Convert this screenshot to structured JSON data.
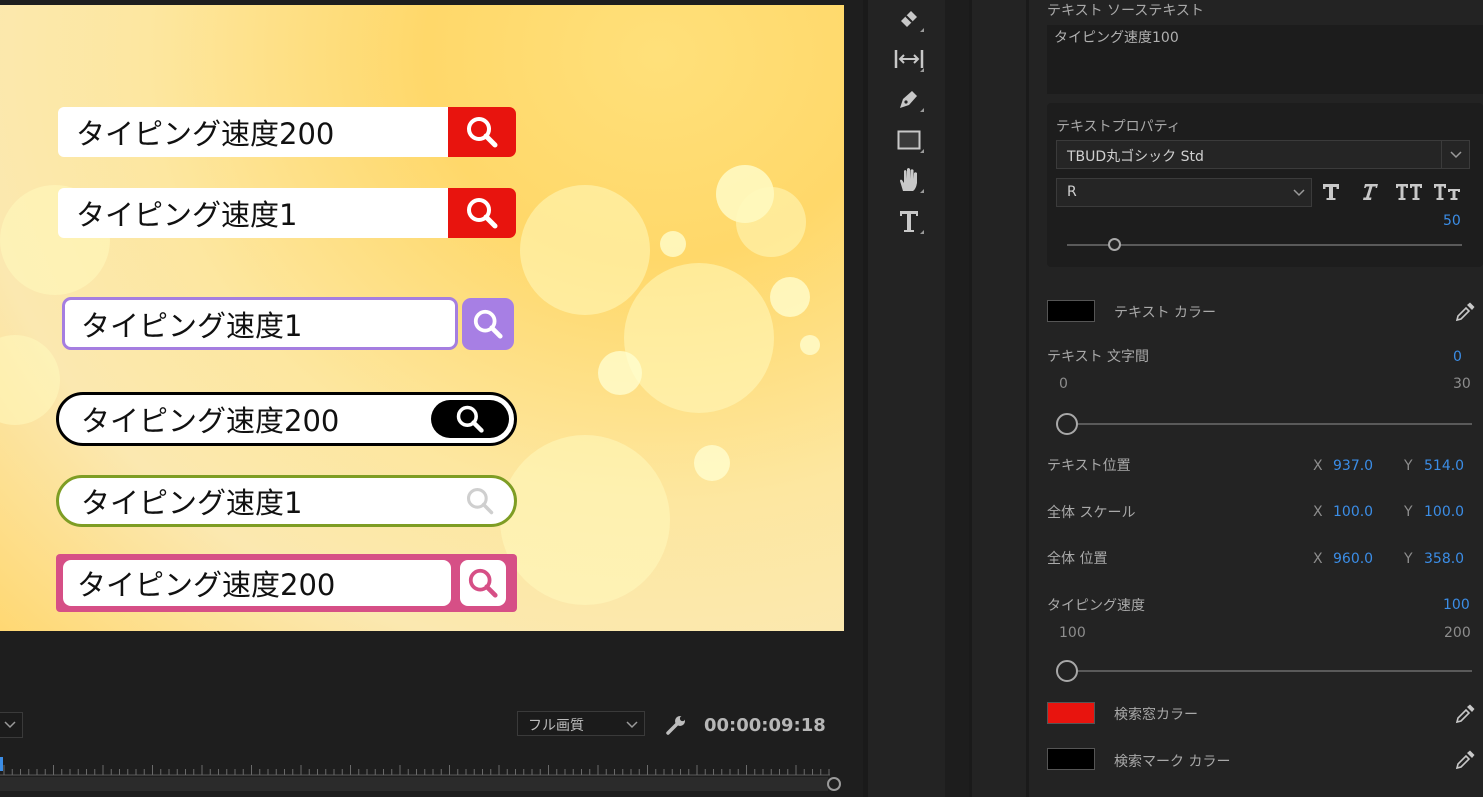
{
  "monitor": {
    "search_bars": [
      {
        "text": "タイピング速度200",
        "style": "red-square"
      },
      {
        "text": "タイピング速度1",
        "style": "red-square"
      },
      {
        "text": "タイピング速度1",
        "style": "purple"
      },
      {
        "text": "タイピング速度200",
        "style": "black-pill"
      },
      {
        "text": "タイピング速度1",
        "style": "green-pill"
      },
      {
        "text": "タイピング速度200",
        "style": "pink"
      }
    ],
    "quality": "フル画質",
    "timecode": "00:00:09:18"
  },
  "tools": [
    "razor-icon",
    "slip-icon",
    "pen-icon",
    "rectangle-icon",
    "hand-icon",
    "type-icon"
  ],
  "props": {
    "source_label": "テキスト ソーステキスト",
    "source_text": "タイピング速度100",
    "text_props_label": "テキストプロパティ",
    "font": "TBUD丸ゴシック Std",
    "weight": "R",
    "size_value": "50",
    "size_fraction": 0.12,
    "color_label": "テキスト カラー",
    "text_color": "#000000",
    "tracking_label": "テキスト 文字間",
    "tracking_value": "0",
    "tracking_min": "0",
    "tracking_max": "30",
    "tracking_fraction": 0.0,
    "position_label": "テキスト位置",
    "position_x": "937.0",
    "position_y": "514.0",
    "scale_label": "全体 スケール",
    "scale_x": "100.0",
    "scale_y": "100.0",
    "global_position_label": "全体 位置",
    "global_x": "960.0",
    "global_y": "358.0",
    "typing_label": "タイピング速度",
    "typing_value": "100",
    "typing_min": "100",
    "typing_max": "200",
    "typing_fraction": 0.0,
    "search_color_label": "検索窓カラー",
    "search_color": "#e8140e",
    "mark_color_label": "検索マーク カラー",
    "mark_color": "#000000",
    "x_label": "X",
    "y_label": "Y"
  }
}
